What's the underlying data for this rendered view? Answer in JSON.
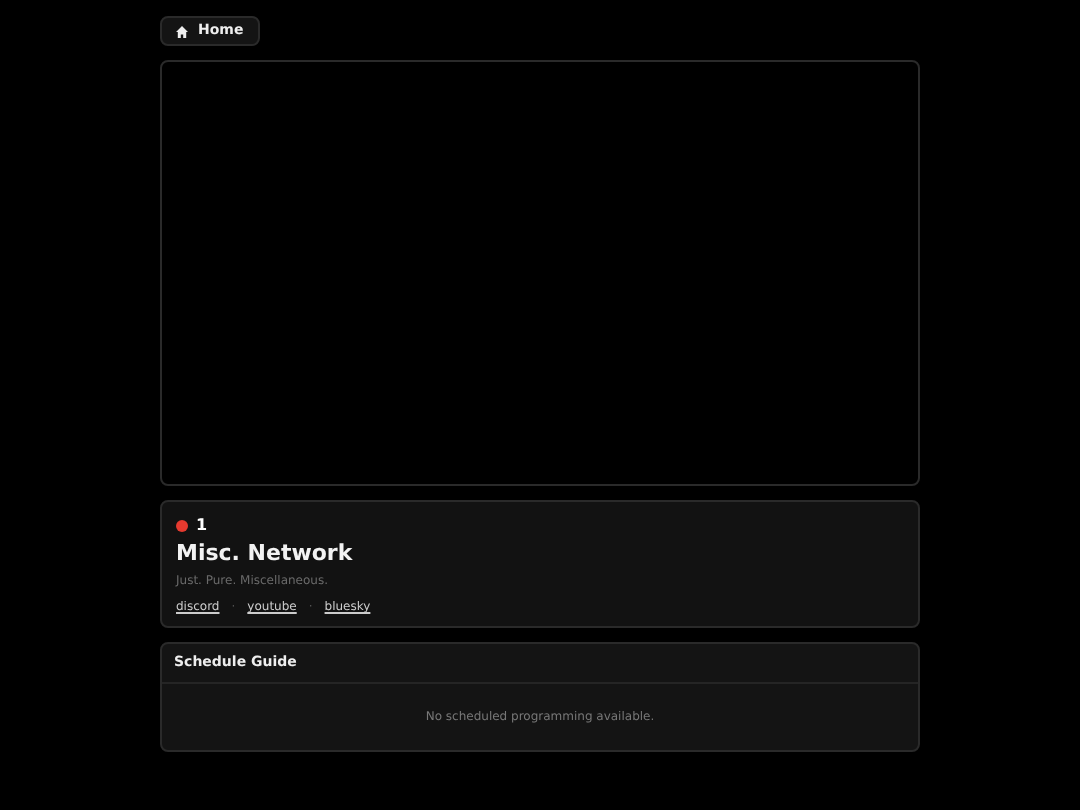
{
  "nav": {
    "home_label": "Home"
  },
  "channel": {
    "viewer_count": "1",
    "name": "Misc. Network",
    "tagline": "Just. Pure. Miscellaneous.",
    "links": [
      {
        "label": "discord"
      },
      {
        "label": "youtube"
      },
      {
        "label": "bluesky"
      }
    ],
    "separators": [
      "·",
      "·"
    ]
  },
  "schedule": {
    "title": "Schedule Guide",
    "empty_message": "No scheduled programming available."
  }
}
